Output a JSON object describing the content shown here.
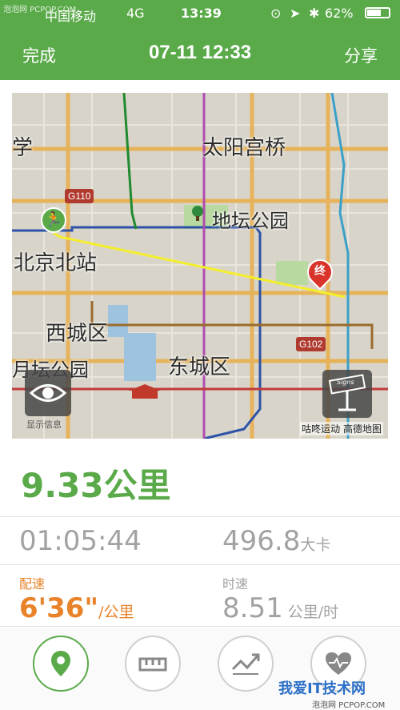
{
  "status_bar": {
    "watermark": "泡泡网 PCPOP.COM",
    "carrier": "中国移动",
    "network": "4G",
    "time": "13:39",
    "battery": "62%"
  },
  "nav": {
    "done_label": "完成",
    "title": "07-11 12:33",
    "share_label": "分享"
  },
  "map": {
    "labels": {
      "taiyanggongqiao": "太阳宫桥",
      "ditan": "地坛公园",
      "beijingbei": "北京北站",
      "xicheng": "西城区",
      "dongcheng": "东城区",
      "yuetan": "月坛公园",
      "xue": "学",
      "g110": "G110",
      "g102": "G102",
      "end_marker": "终",
      "eye_caption": "显示信息",
      "sign_caption": "Signs",
      "provider": "咕咚运动 高德地图"
    },
    "colors": {
      "track": "#f3ee2e",
      "start": "#5aaa4a",
      "end": "#d9342b"
    }
  },
  "stats": {
    "distance": "9.33公里",
    "duration": "01:05:44",
    "calories_value": "496.8",
    "calories_unit": "大卡",
    "pace_label": "配速",
    "pace_value": "6'36\"",
    "pace_unit": "/公里",
    "speed_label": "时速",
    "speed_value": "8.51",
    "speed_unit": "公里/时"
  },
  "tabs": [
    {
      "icon": "location-pin-icon",
      "active": true
    },
    {
      "icon": "ruler-icon",
      "active": false
    },
    {
      "icon": "speed-chart-icon",
      "active": false
    },
    {
      "icon": "heart-rate-icon",
      "active": false
    }
  ],
  "watermark": {
    "main": "我爱IT技术网",
    "sub": "泡泡网 PCPOP.COM"
  }
}
